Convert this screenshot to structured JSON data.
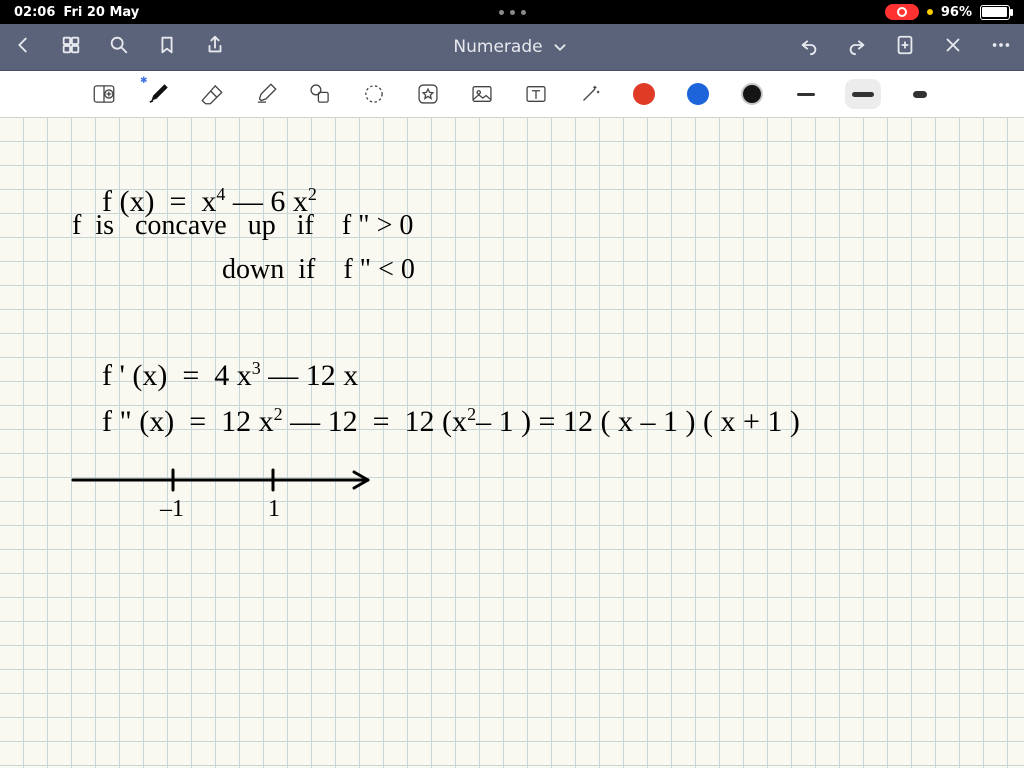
{
  "status": {
    "time": "02:06",
    "date": "Fri 20 May",
    "battery_pct": "96%"
  },
  "nav": {
    "title": "Numerade"
  },
  "tools": {
    "colors": {
      "red": "#e03b25",
      "blue": "#1d63d9",
      "black": "#151515"
    },
    "selected_weight": "medium"
  },
  "handwriting": {
    "line1_a": "f (x)  =  x",
    "line1_b": " — 6 x",
    "line1_sup1": "4",
    "line1_sup2": "2",
    "line2": "f  is   concave   up   if    f \" > 0",
    "line3": "down  if    f \" < 0",
    "line4_a": "f ' (x)  =  4 x",
    "line4_sup": "3",
    "line4_b": " — 12 x",
    "line5_a": "f \" (x)  =  12 x",
    "line5_sup": "2",
    "line5_b": " — 12  =  12 (x",
    "line5_sup2": "2",
    "line5_c": "– 1 ) = 12 ( x – 1 ) ( x + 1 )",
    "numberline_labels": {
      "left": "–1",
      "right": "1"
    }
  }
}
